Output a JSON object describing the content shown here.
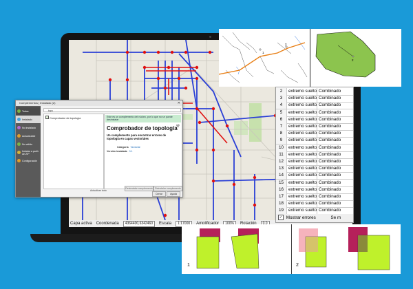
{
  "dialog": {
    "title": "Complementos | Instalado (2)",
    "close_glyph": "✕",
    "sidebar": [
      {
        "label": "Todos",
        "color": "#7ab648"
      },
      {
        "label": "Instalado",
        "color": "#4aa3df"
      },
      {
        "label": "No instalado",
        "color": "#b36ad6"
      },
      {
        "label": "Actualizable",
        "color": "#e0a02c"
      },
      {
        "label": "No válido",
        "color": "#7ab648"
      },
      {
        "label": "Instalar a partir de ZIP",
        "color": "#d4b53a"
      },
      {
        "label": "Configuración",
        "color": "#e0a02c"
      }
    ],
    "search_value": "topo",
    "list_item": "Comprobador de topología",
    "banner": "Este es un complemento del núcleo, por lo que no se puede desinstalar",
    "detail_title": "Comprobador de topología",
    "detail_desc": "Un complemento para encontrar errores de topología en capas vectoriales",
    "category_label": "Categoría",
    "category_value": "Vectorial",
    "version_label": "Versión instalada",
    "version_value": "0.1",
    "upgrade_all_label": "Actualizar todo",
    "uninstall_button": "Desinstalar complemento",
    "reinstall_button": "Reinstalar complemento",
    "close_button": "Cerrar",
    "help_button": "Ayuda"
  },
  "status_bar": {
    "active_layer": "Capa activa",
    "coordinate_label": "Coordenada",
    "coordinate_value": "4364400,6342460",
    "scale_label": "Escala",
    "scale_value": "1:17000",
    "magnifier_label": "Amplificador",
    "magnifier_value": "100%",
    "rotation_label": "Rotación",
    "rotation_value": "0.0"
  },
  "errors_table": {
    "rows": [
      {
        "n": "2",
        "error": "extremo suelto",
        "layer": "Combinado"
      },
      {
        "n": "3",
        "error": "extremo suelto",
        "layer": "Combinado"
      },
      {
        "n": "4",
        "error": "extremo suelto",
        "layer": "Combinado"
      },
      {
        "n": "5",
        "error": "extremo suelto",
        "layer": "Combinado"
      },
      {
        "n": "6",
        "error": "extremo suelto",
        "layer": "Combinado"
      },
      {
        "n": "7",
        "error": "extremo suelto",
        "layer": "Combinado"
      },
      {
        "n": "8",
        "error": "extremo suelto",
        "layer": "Combinado"
      },
      {
        "n": "9",
        "error": "extremo suelto",
        "layer": "Combinado"
      },
      {
        "n": "10",
        "error": "extremo suelto",
        "layer": "Combinado"
      },
      {
        "n": "11",
        "error": "extremo suelto",
        "layer": "Combinado"
      },
      {
        "n": "12",
        "error": "extremo suelto",
        "layer": "Combinado"
      },
      {
        "n": "13",
        "error": "extremo suelto",
        "layer": "Combinado"
      },
      {
        "n": "14",
        "error": "extremo suelto",
        "layer": "Combinado"
      },
      {
        "n": "15",
        "error": "extremo suelto",
        "layer": "Combinado"
      },
      {
        "n": "16",
        "error": "extremo suelto",
        "layer": "Combinado"
      },
      {
        "n": "17",
        "error": "extremo suelto",
        "layer": "Combinado"
      },
      {
        "n": "18",
        "error": "extremo suelto",
        "layer": "Combinado"
      },
      {
        "n": "19",
        "error": "extremo suelto",
        "layer": "Combinado"
      }
    ],
    "show_errors_label": "Mostrar errores",
    "show_errors_checked": true,
    "trailing_text": "Se m"
  },
  "insets": {
    "roads_label_1": "1",
    "roads_label_2": "2",
    "polygon_label": "2"
  },
  "examples": {
    "label_1": "1",
    "label_2": "2"
  },
  "colors": {
    "background": "#1a9ad8",
    "road_blue": "#2a3fd6",
    "node_red": "#e01010",
    "polygon_green": "#8cc44e",
    "example_lime": "#bff12b",
    "example_magenta": "#b5205a"
  }
}
